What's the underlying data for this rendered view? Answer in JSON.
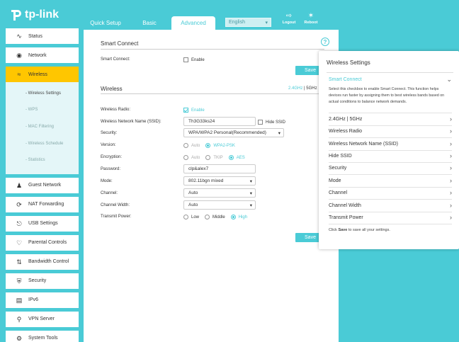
{
  "brand": "tp-link",
  "colors": {
    "accent": "#4acbd6",
    "active_menu": "#ffc600"
  },
  "topnav": {
    "tabs": [
      "Quick Setup",
      "Basic",
      "Advanced"
    ],
    "active": "Advanced"
  },
  "language": "English",
  "logout_label": "Logout",
  "reboot_label": "Reboot",
  "sidebar": {
    "items": [
      {
        "label": "Status",
        "icon": "status-icon"
      },
      {
        "label": "Network",
        "icon": "globe-icon"
      },
      {
        "label": "Wireless",
        "icon": "wifi-icon"
      }
    ],
    "sub": [
      "- Wireless Settings",
      "- WPS",
      "- MAC Filtering",
      "- Wireless Schedule",
      "- Statistics"
    ],
    "items2": [
      {
        "label": "Guest Network",
        "icon": "guest-icon"
      },
      {
        "label": "NAT Forwarding",
        "icon": "nat-icon"
      },
      {
        "label": "USB Settings",
        "icon": "usb-icon"
      },
      {
        "label": "Parental Controls",
        "icon": "heart-icon"
      },
      {
        "label": "Bandwidth Control",
        "icon": "bandwidth-icon"
      },
      {
        "label": "Security",
        "icon": "shield-icon"
      },
      {
        "label": "IPv6",
        "icon": "ipv6-icon"
      },
      {
        "label": "VPN Server",
        "icon": "vpn-icon"
      },
      {
        "label": "System Tools",
        "icon": "gear-icon"
      }
    ]
  },
  "smart_connect": {
    "title": "Smart Connect",
    "label": "Smart Connect:",
    "enable": "Enable",
    "save": "Save"
  },
  "wireless": {
    "title": "Wireless",
    "band_24": "2.4GHz",
    "band_sep": "|",
    "band_5": "5GHz",
    "radio_label": "Wireless Radio:",
    "radio_value": "Enable",
    "ssid_label": "Wireless Network Name (SSID):",
    "ssid_value": "Th3G33ks24",
    "hide_ssid": "Hide SSID",
    "security_label": "Security:",
    "security_value": "WPA/WPA2 Personal(Recommended)",
    "version_label": "Version:",
    "version_opts": [
      "Auto",
      "WPA2-PSK"
    ],
    "encryption_label": "Encryption:",
    "encryption_opts": [
      "Auto",
      "TKIP",
      "AES"
    ],
    "password_label": "Password:",
    "password_value": "clp&alex7",
    "mode_label": "Mode:",
    "mode_value": "802.11bgn mixed",
    "channel_label": "Channel:",
    "channel_value": "Auto",
    "width_label": "Channel Width:",
    "width_value": "Auto",
    "power_label": "Transmit Power:",
    "power_opts": [
      "Low",
      "Middle",
      "High"
    ],
    "save": "Save"
  },
  "help_panel": {
    "title": "Wireless Settings",
    "smart_connect": "Smart Connect",
    "description": "Select this checkbox to enable Smart Connect. This function helps devices run faster by assigning them to best wireless bands based on actual conditions to balance network demands.",
    "rows": [
      "2.4GHz | 5GHz",
      "Wireless Radio",
      "Wireless Network Name (SSID)",
      "Hide SSID",
      "Security",
      "Mode",
      "Channel",
      "Channel Width",
      "Transmit Power"
    ],
    "foot_pre": "Click ",
    "foot_bold": "Save",
    "foot_post": " to save all your settings."
  }
}
